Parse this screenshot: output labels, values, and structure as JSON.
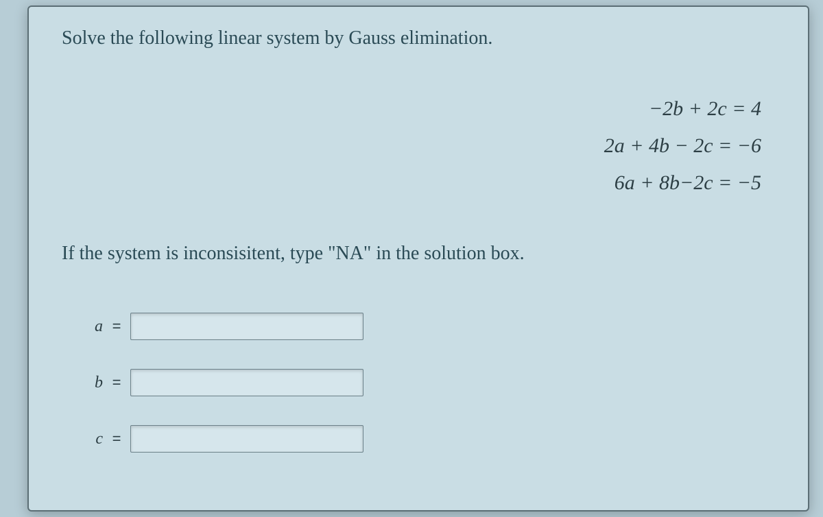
{
  "problem": {
    "title": "Solve the following linear system by Gauss elimination.",
    "equations": {
      "eq1_lhs_html": "−2<span>b</span> + 2<span>c</span>",
      "eq1_rhs": "4",
      "eq2_lhs_html": "2<span>a</span> + 4<span>b</span> − 2<span>c</span>",
      "eq2_rhs": "−6",
      "eq3_lhs_html": "6<span>a</span> + 8<span>b</span>−2<span>c</span>",
      "eq3_rhs": "−5"
    },
    "eq1": "−2b + 2c = 4",
    "eq2": "2a + 4b − 2c = −6",
    "eq3": "6a + 8b−2c = −5",
    "instruction": "If the system is inconsisitent, type \"NA\" in the solution box.",
    "answers": {
      "a": {
        "label": "a",
        "equals": "=",
        "value": ""
      },
      "b": {
        "label": "b",
        "equals": "=",
        "value": ""
      },
      "c": {
        "label": "c",
        "equals": "=",
        "value": ""
      }
    }
  }
}
